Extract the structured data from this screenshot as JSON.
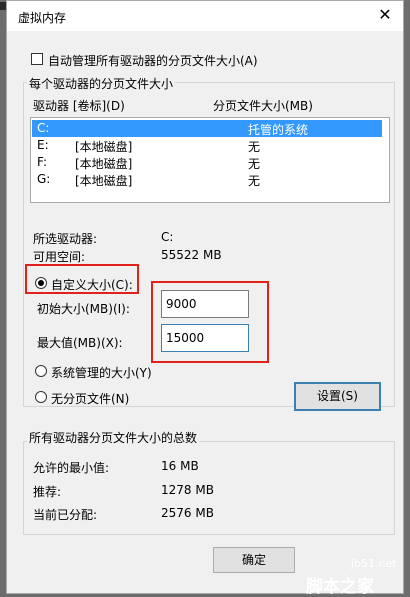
{
  "window": {
    "title": "虚拟内存",
    "close_icon": "close-icon"
  },
  "auto_manage": {
    "label": "自动管理所有驱动器的分页文件大小(A)",
    "checked": false
  },
  "drives_group": {
    "label": "每个驱动器的分页文件大小",
    "col_drive": "驱动器 [卷标](D)",
    "col_size": "分页文件大小(MB)",
    "rows": [
      {
        "drive": "C:",
        "label": "",
        "size": "托管的系统",
        "selected": true
      },
      {
        "drive": "E:",
        "label": "[本地磁盘]",
        "size": "无"
      },
      {
        "drive": "F:",
        "label": "[本地磁盘]",
        "size": "无"
      },
      {
        "drive": "G:",
        "label": "[本地磁盘]",
        "size": "无"
      }
    ],
    "selected_drive_label": "所选驱动器:",
    "selected_drive_value": "C:",
    "free_space_label": "可用空间:",
    "free_space_value": "55522 MB",
    "custom_size_label": "自定义大小(C):",
    "initial_label": "初始大小(MB)(I):",
    "initial_value": "9000",
    "max_label": "最大值(MB)(X):",
    "max_value": "15000",
    "system_managed_label": "系统管理的大小(Y)",
    "no_paging_label": "无分页文件(N)",
    "set_button": "设置(S)"
  },
  "totals_group": {
    "label": "所有驱动器分页文件大小的总数",
    "min_label": "允许的最小值:",
    "min_value": "16 MB",
    "recommended_label": "推荐:",
    "recommended_value": "1278 MB",
    "current_label": "当前已分配:",
    "current_value": "2576 MB"
  },
  "footer": {
    "ok_button": "确定"
  },
  "watermark": {
    "site": "jb51.net",
    "name": "脚本之家"
  },
  "colors": {
    "highlight": "#3399ff",
    "red_annotation": "#e0221a"
  }
}
